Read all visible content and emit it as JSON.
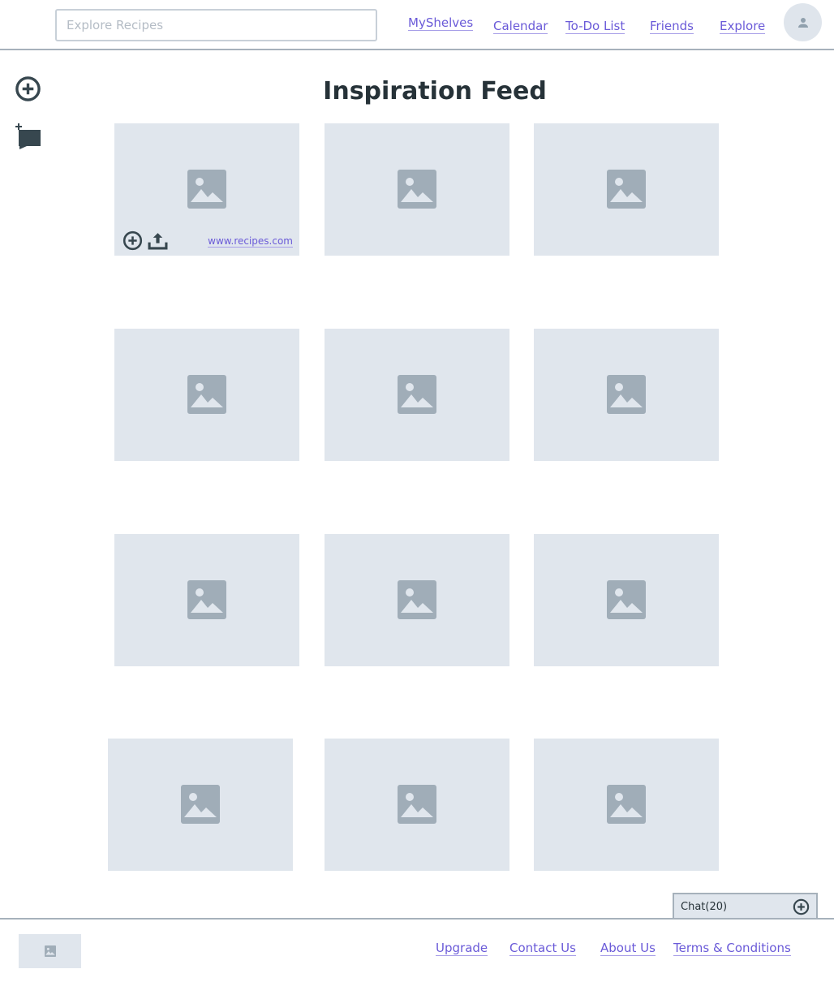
{
  "header": {
    "search_placeholder": "Explore Recipes",
    "nav": {
      "myshelves": "MyShelves",
      "calendar": "Calendar",
      "todo": "To-Do List",
      "friends": "Friends",
      "explore": "Explore"
    }
  },
  "main": {
    "title": "Inspiration Feed",
    "cards": [
      {
        "link": "www.recipes.com"
      }
    ]
  },
  "chat": {
    "label": "Chat(20)"
  },
  "footer": {
    "links": {
      "upgrade": "Upgrade",
      "contact": "Contact Us",
      "about": "About Us",
      "terms": "Terms & Conditions"
    }
  },
  "colors": {
    "link": "#6a5ad8",
    "placeholder_bg": "#e0e6ed",
    "icon": "#37474f",
    "image_icon": "#a0adb8"
  },
  "icons": [
    "add-circle-icon",
    "add-comment-icon",
    "image-placeholder-icon",
    "upload-icon",
    "user-icon"
  ]
}
